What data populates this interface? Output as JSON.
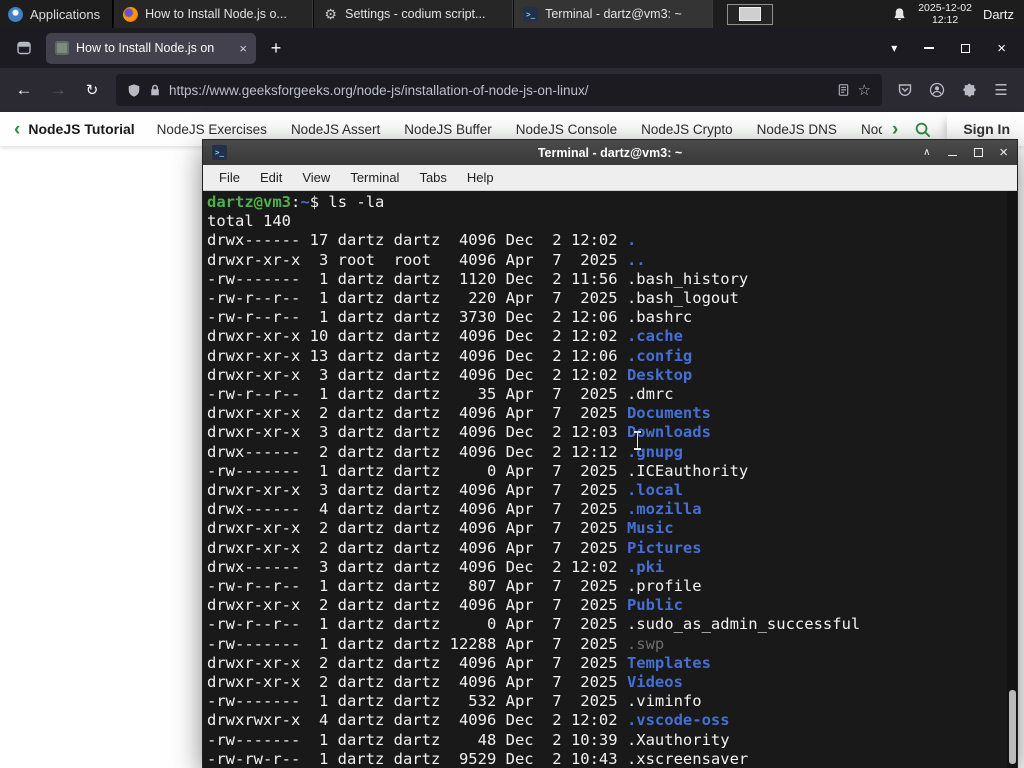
{
  "colors": {
    "accent_green": "#2f8d46",
    "dir_blue": "#466fd5",
    "prompt_green": "#4eb04e",
    "dim_file": "#6e6e6e",
    "term_bg": "#191919",
    "term_fg": "#f2f2f2"
  },
  "taskbar": {
    "applications": "Applications",
    "windows": [
      {
        "title": "How to Install Node.js o...",
        "icon": "firefox",
        "active": false
      },
      {
        "title": "Settings - codium script...",
        "icon": "settings-gear",
        "active": false
      },
      {
        "title": "Terminal - dartz@vm3: ~",
        "icon": "terminal",
        "active": true
      }
    ],
    "clock": {
      "date": "2025-12-02",
      "time": "12:12"
    },
    "user": "Dartz"
  },
  "browser": {
    "tab": {
      "title": "How to Install Node.js on"
    },
    "url": "https://www.geeksforgeeks.org/node-js/installation-of-node-js-on-linux/"
  },
  "site_nav": {
    "back": "NodeJS Tutorial",
    "items": [
      "NodeJS Exercises",
      "NodeJS Assert",
      "NodeJS Buffer",
      "NodeJS Console",
      "NodeJS Crypto",
      "NodeJS DNS",
      "Node"
    ],
    "sign_in": "Sign In"
  },
  "terminal": {
    "title": "Terminal - dartz@vm3: ~",
    "menu": [
      "File",
      "Edit",
      "View",
      "Terminal",
      "Tabs",
      "Help"
    ],
    "prompt": {
      "userhost": "dartz@vm3",
      "separator": ":",
      "path": "~",
      "symbol": "$"
    },
    "command": "ls -la",
    "total": "total 140",
    "listing": [
      {
        "perms": "drwx------",
        "links": 17,
        "owner": "dartz",
        "group": "dartz",
        "size": 4096,
        "month": "Dec",
        "day": 2,
        "time": "12:02",
        "name": ".",
        "kind": "dir"
      },
      {
        "perms": "drwxr-xr-x",
        "links": 3,
        "owner": "root",
        "group": "root",
        "size": 4096,
        "month": "Apr",
        "day": 7,
        "time": "2025",
        "name": "..",
        "kind": "dir"
      },
      {
        "perms": "-rw-------",
        "links": 1,
        "owner": "dartz",
        "group": "dartz",
        "size": 1120,
        "month": "Dec",
        "day": 2,
        "time": "11:56",
        "name": ".bash_history",
        "kind": "file"
      },
      {
        "perms": "-rw-r--r--",
        "links": 1,
        "owner": "dartz",
        "group": "dartz",
        "size": 220,
        "month": "Apr",
        "day": 7,
        "time": "2025",
        "name": ".bash_logout",
        "kind": "file"
      },
      {
        "perms": "-rw-r--r--",
        "links": 1,
        "owner": "dartz",
        "group": "dartz",
        "size": 3730,
        "month": "Dec",
        "day": 2,
        "time": "12:06",
        "name": ".bashrc",
        "kind": "file"
      },
      {
        "perms": "drwxr-xr-x",
        "links": 10,
        "owner": "dartz",
        "group": "dartz",
        "size": 4096,
        "month": "Dec",
        "day": 2,
        "time": "12:02",
        "name": ".cache",
        "kind": "dir"
      },
      {
        "perms": "drwxr-xr-x",
        "links": 13,
        "owner": "dartz",
        "group": "dartz",
        "size": 4096,
        "month": "Dec",
        "day": 2,
        "time": "12:06",
        "name": ".config",
        "kind": "dir"
      },
      {
        "perms": "drwxr-xr-x",
        "links": 3,
        "owner": "dartz",
        "group": "dartz",
        "size": 4096,
        "month": "Dec",
        "day": 2,
        "time": "12:02",
        "name": "Desktop",
        "kind": "dir"
      },
      {
        "perms": "-rw-r--r--",
        "links": 1,
        "owner": "dartz",
        "group": "dartz",
        "size": 35,
        "month": "Apr",
        "day": 7,
        "time": "2025",
        "name": ".dmrc",
        "kind": "file"
      },
      {
        "perms": "drwxr-xr-x",
        "links": 2,
        "owner": "dartz",
        "group": "dartz",
        "size": 4096,
        "month": "Apr",
        "day": 7,
        "time": "2025",
        "name": "Documents",
        "kind": "dir"
      },
      {
        "perms": "drwxr-xr-x",
        "links": 3,
        "owner": "dartz",
        "group": "dartz",
        "size": 4096,
        "month": "Dec",
        "day": 2,
        "time": "12:03",
        "name": "Downloads",
        "kind": "dir"
      },
      {
        "perms": "drwx------",
        "links": 2,
        "owner": "dartz",
        "group": "dartz",
        "size": 4096,
        "month": "Dec",
        "day": 2,
        "time": "12:12",
        "name": ".gnupg",
        "kind": "dir"
      },
      {
        "perms": "-rw-------",
        "links": 1,
        "owner": "dartz",
        "group": "dartz",
        "size": 0,
        "month": "Apr",
        "day": 7,
        "time": "2025",
        "name": ".ICEauthority",
        "kind": "file"
      },
      {
        "perms": "drwxr-xr-x",
        "links": 3,
        "owner": "dartz",
        "group": "dartz",
        "size": 4096,
        "month": "Apr",
        "day": 7,
        "time": "2025",
        "name": ".local",
        "kind": "dir"
      },
      {
        "perms": "drwx------",
        "links": 4,
        "owner": "dartz",
        "group": "dartz",
        "size": 4096,
        "month": "Apr",
        "day": 7,
        "time": "2025",
        "name": ".mozilla",
        "kind": "dir"
      },
      {
        "perms": "drwxr-xr-x",
        "links": 2,
        "owner": "dartz",
        "group": "dartz",
        "size": 4096,
        "month": "Apr",
        "day": 7,
        "time": "2025",
        "name": "Music",
        "kind": "dir"
      },
      {
        "perms": "drwxr-xr-x",
        "links": 2,
        "owner": "dartz",
        "group": "dartz",
        "size": 4096,
        "month": "Apr",
        "day": 7,
        "time": "2025",
        "name": "Pictures",
        "kind": "dir"
      },
      {
        "perms": "drwx------",
        "links": 3,
        "owner": "dartz",
        "group": "dartz",
        "size": 4096,
        "month": "Dec",
        "day": 2,
        "time": "12:02",
        "name": ".pki",
        "kind": "dir"
      },
      {
        "perms": "-rw-r--r--",
        "links": 1,
        "owner": "dartz",
        "group": "dartz",
        "size": 807,
        "month": "Apr",
        "day": 7,
        "time": "2025",
        "name": ".profile",
        "kind": "file"
      },
      {
        "perms": "drwxr-xr-x",
        "links": 2,
        "owner": "dartz",
        "group": "dartz",
        "size": 4096,
        "month": "Apr",
        "day": 7,
        "time": "2025",
        "name": "Public",
        "kind": "dir"
      },
      {
        "perms": "-rw-r--r--",
        "links": 1,
        "owner": "dartz",
        "group": "dartz",
        "size": 0,
        "month": "Apr",
        "day": 7,
        "time": "2025",
        "name": ".sudo_as_admin_successful",
        "kind": "file"
      },
      {
        "perms": "-rw-------",
        "links": 1,
        "owner": "dartz",
        "group": "dartz",
        "size": 12288,
        "month": "Apr",
        "day": 7,
        "time": "2025",
        "name": ".swp",
        "kind": "dim"
      },
      {
        "perms": "drwxr-xr-x",
        "links": 2,
        "owner": "dartz",
        "group": "dartz",
        "size": 4096,
        "month": "Apr",
        "day": 7,
        "time": "2025",
        "name": "Templates",
        "kind": "dir"
      },
      {
        "perms": "drwxr-xr-x",
        "links": 2,
        "owner": "dartz",
        "group": "dartz",
        "size": 4096,
        "month": "Apr",
        "day": 7,
        "time": "2025",
        "name": "Videos",
        "kind": "dir"
      },
      {
        "perms": "-rw-------",
        "links": 1,
        "owner": "dartz",
        "group": "dartz",
        "size": 532,
        "month": "Apr",
        "day": 7,
        "time": "2025",
        "name": ".viminfo",
        "kind": "file"
      },
      {
        "perms": "drwxrwxr-x",
        "links": 4,
        "owner": "dartz",
        "group": "dartz",
        "size": 4096,
        "month": "Dec",
        "day": 2,
        "time": "12:02",
        "name": ".vscode-oss",
        "kind": "dir"
      },
      {
        "perms": "-rw-------",
        "links": 1,
        "owner": "dartz",
        "group": "dartz",
        "size": 48,
        "month": "Dec",
        "day": 2,
        "time": "10:39",
        "name": ".Xauthority",
        "kind": "file"
      },
      {
        "perms": "-rw-rw-r--",
        "links": 1,
        "owner": "dartz",
        "group": "dartz",
        "size": 9529,
        "month": "Dec",
        "day": 2,
        "time": "10:43",
        "name": ".xscreensaver",
        "kind": "file"
      }
    ]
  }
}
